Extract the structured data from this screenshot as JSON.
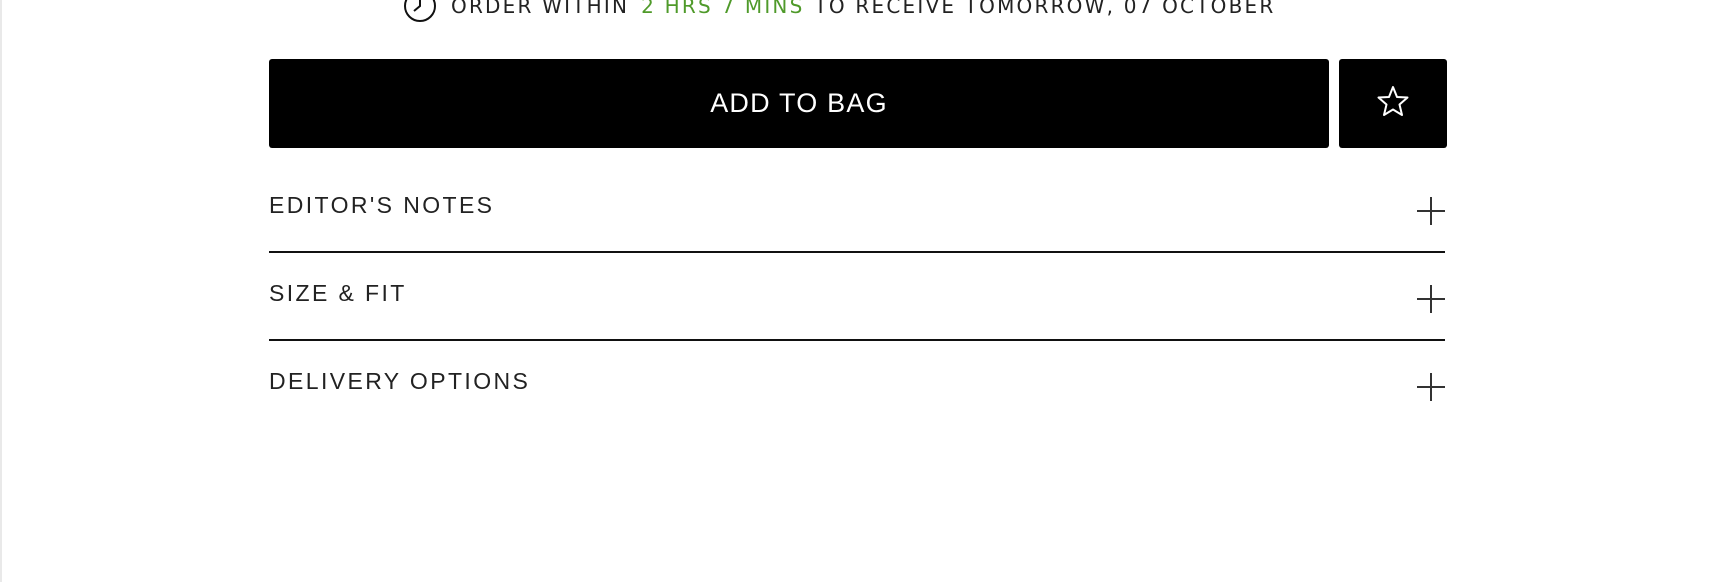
{
  "delivery": {
    "prefix": "ORDER WITHIN",
    "countdown": "2 HRS 7 MINS",
    "suffix": "TO RECEIVE TOMORROW, 07 OCTOBER",
    "icon": "clock-icon",
    "countdown_color": "#4f9a2a"
  },
  "actions": {
    "add_to_bag_label": "ADD TO BAG",
    "wishlist_icon": "star-icon"
  },
  "accordion": {
    "items": [
      {
        "label": "EDITOR'S NOTES",
        "icon": "plus-icon"
      },
      {
        "label": "SIZE & FIT",
        "icon": "plus-icon"
      },
      {
        "label": "DELIVERY OPTIONS",
        "icon": "plus-icon"
      }
    ]
  },
  "colors": {
    "button_bg": "#000000",
    "button_text": "#ffffff",
    "text": "#222222"
  }
}
